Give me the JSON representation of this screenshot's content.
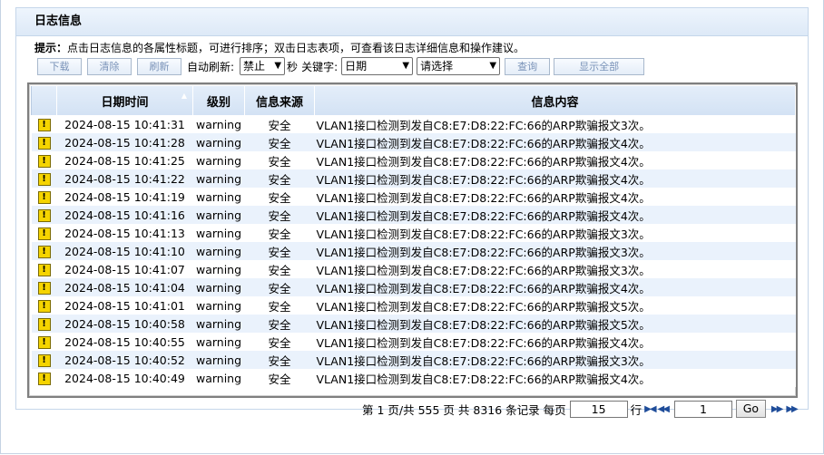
{
  "panel": {
    "title": "日志信息"
  },
  "hint": {
    "label": "提示：",
    "text": "点击日志信息的各属性标题，可进行排序；双击日志表项，可查看该日志详细信息和操作建议。"
  },
  "toolbar": {
    "download": "下载",
    "clear": "清除",
    "refresh": "刷新",
    "auto_refresh_label": "自动刷新:",
    "auto_refresh_value": "禁止",
    "seconds_label": "秒",
    "keyword_label": "关键字:",
    "keyword_field": "日期",
    "keyword_value": "请选择",
    "query": "查询",
    "show_all": "显示全部"
  },
  "table": {
    "headers": [
      "日期时间",
      "级别",
      "信息来源",
      "信息内容"
    ],
    "rows": [
      {
        "time": "2024-08-15 10:41:31",
        "level": "warning",
        "source": "安全",
        "msg": "VLAN1接口检测到发自C8:E7:D8:22:FC:66的ARP欺骗报文3次。"
      },
      {
        "time": "2024-08-15 10:41:28",
        "level": "warning",
        "source": "安全",
        "msg": "VLAN1接口检测到发自C8:E7:D8:22:FC:66的ARP欺骗报文4次。"
      },
      {
        "time": "2024-08-15 10:41:25",
        "level": "warning",
        "source": "安全",
        "msg": "VLAN1接口检测到发自C8:E7:D8:22:FC:66的ARP欺骗报文4次。"
      },
      {
        "time": "2024-08-15 10:41:22",
        "level": "warning",
        "source": "安全",
        "msg": "VLAN1接口检测到发自C8:E7:D8:22:FC:66的ARP欺骗报文4次。"
      },
      {
        "time": "2024-08-15 10:41:19",
        "level": "warning",
        "source": "安全",
        "msg": "VLAN1接口检测到发自C8:E7:D8:22:FC:66的ARP欺骗报文4次。"
      },
      {
        "time": "2024-08-15 10:41:16",
        "level": "warning",
        "source": "安全",
        "msg": "VLAN1接口检测到发自C8:E7:D8:22:FC:66的ARP欺骗报文4次。"
      },
      {
        "time": "2024-08-15 10:41:13",
        "level": "warning",
        "source": "安全",
        "msg": "VLAN1接口检测到发自C8:E7:D8:22:FC:66的ARP欺骗报文3次。"
      },
      {
        "time": "2024-08-15 10:41:10",
        "level": "warning",
        "source": "安全",
        "msg": "VLAN1接口检测到发自C8:E7:D8:22:FC:66的ARP欺骗报文3次。"
      },
      {
        "time": "2024-08-15 10:41:07",
        "level": "warning",
        "source": "安全",
        "msg": "VLAN1接口检测到发自C8:E7:D8:22:FC:66的ARP欺骗报文3次。"
      },
      {
        "time": "2024-08-15 10:41:04",
        "level": "warning",
        "source": "安全",
        "msg": "VLAN1接口检测到发自C8:E7:D8:22:FC:66的ARP欺骗报文4次。"
      },
      {
        "time": "2024-08-15 10:41:01",
        "level": "warning",
        "source": "安全",
        "msg": "VLAN1接口检测到发自C8:E7:D8:22:FC:66的ARP欺骗报文5次。"
      },
      {
        "time": "2024-08-15 10:40:58",
        "level": "warning",
        "source": "安全",
        "msg": "VLAN1接口检测到发自C8:E7:D8:22:FC:66的ARP欺骗报文5次。"
      },
      {
        "time": "2024-08-15 10:40:55",
        "level": "warning",
        "source": "安全",
        "msg": "VLAN1接口检测到发自C8:E7:D8:22:FC:66的ARP欺骗报文4次。"
      },
      {
        "time": "2024-08-15 10:40:52",
        "level": "warning",
        "source": "安全",
        "msg": "VLAN1接口检测到发自C8:E7:D8:22:FC:66的ARP欺骗报文3次。"
      },
      {
        "time": "2024-08-15 10:40:49",
        "level": "warning",
        "source": "安全",
        "msg": "VLAN1接口检测到发自C8:E7:D8:22:FC:66的ARP欺骗报文4次。"
      }
    ]
  },
  "pager": {
    "text": "第 1 页/共 555 页 共 8316 条记录 每页",
    "per_page": "15",
    "row_label": "行",
    "page_input": "1",
    "go": "Go"
  },
  "icons": {
    "row": "warning-icon"
  },
  "colors": {
    "header_bg": "#dbe7f6",
    "row_alt": "#eaf2fc",
    "warn": "#f5d400"
  }
}
